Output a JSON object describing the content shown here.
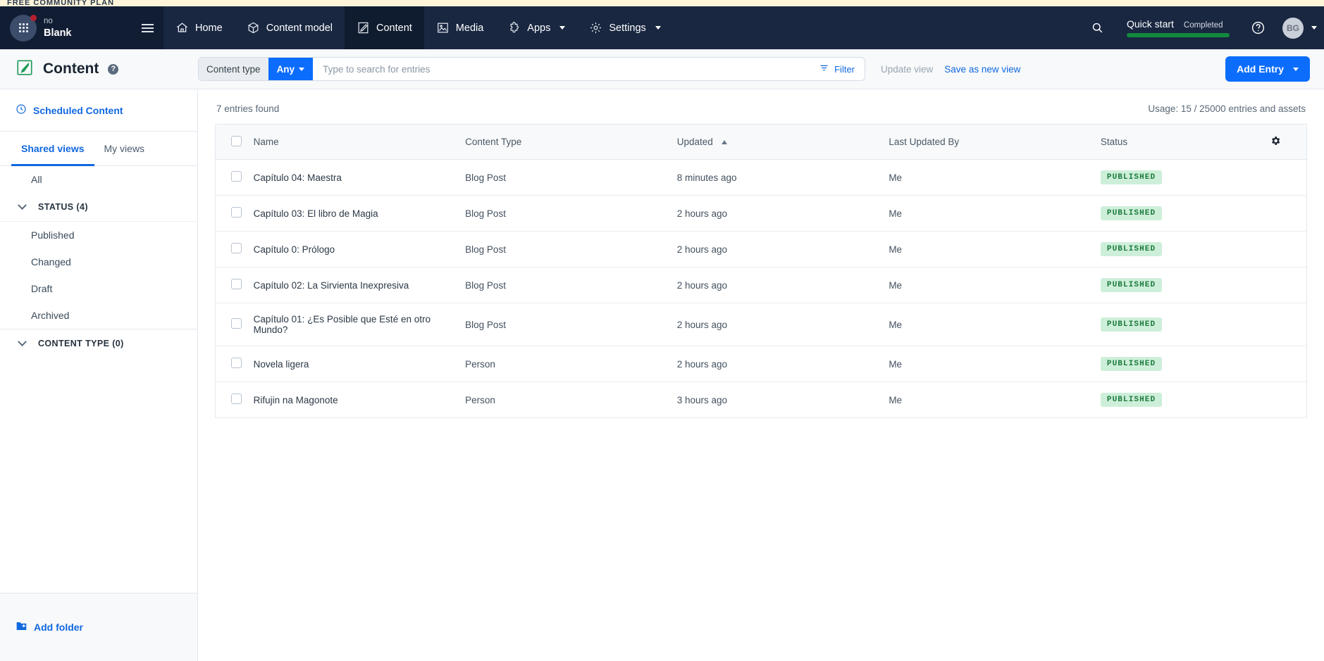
{
  "promo_banner": {
    "text": "FREE COMMUNITY PLAN"
  },
  "topnav": {
    "space": {
      "org_label": "no",
      "name": "Blank",
      "icon": "grid-apps-icon",
      "badge": "notification-dot"
    },
    "menu_icon": "hamburger-icon",
    "items": [
      {
        "label": "Home",
        "icon": "house-icon",
        "active": false,
        "has_caret": false
      },
      {
        "label": "Content model",
        "icon": "box-model-icon",
        "active": false,
        "has_caret": false
      },
      {
        "label": "Content",
        "icon": "pen-document-icon",
        "active": true,
        "has_caret": false
      },
      {
        "label": "Media",
        "icon": "image-frame-icon",
        "active": false,
        "has_caret": false
      },
      {
        "label": "Apps",
        "icon": "puzzle-piece-icon",
        "active": false,
        "has_caret": true
      },
      {
        "label": "Settings",
        "icon": "gear-icon",
        "active": false,
        "has_caret": true
      }
    ],
    "search_icon": "search-icon",
    "quick_start": {
      "title": "Quick start",
      "status": "Completed",
      "progress_percent": 100,
      "bar_color": "#128a3c"
    },
    "help_icon": "question-circle-icon",
    "avatar": {
      "initials": "BG"
    }
  },
  "page_header": {
    "icon": "content-pen-icon",
    "title": "Content",
    "help_icon": "question-circle-icon",
    "content_type_filter": {
      "label": "Content type",
      "value": "Any",
      "caret": "chevron-down-icon"
    },
    "search": {
      "placeholder": "Type to search for entries",
      "value": ""
    },
    "filter": {
      "label": "Filter",
      "icon": "filter-icon"
    },
    "update_view": "Update view",
    "save_as_new_view": "Save as new view",
    "add_entry": {
      "label": "Add Entry",
      "caret": "chevron-down-icon"
    }
  },
  "sidebar": {
    "scheduled_content": {
      "label": "Scheduled Content",
      "icon": "clock-icon"
    },
    "tabs": [
      {
        "label": "Shared views",
        "active": true
      },
      {
        "label": "My views",
        "active": false
      }
    ],
    "all_label": "All",
    "groups": [
      {
        "label": "STATUS (4)",
        "expanded": true,
        "items": [
          {
            "label": "Published"
          },
          {
            "label": "Changed"
          },
          {
            "label": "Draft"
          },
          {
            "label": "Archived"
          }
        ]
      },
      {
        "label": "CONTENT TYPE (0)",
        "expanded": true,
        "items": []
      }
    ],
    "add_folder": {
      "label": "Add folder",
      "icon": "folder-plus-icon"
    }
  },
  "main": {
    "entries_found": "7 entries found",
    "usage": "Usage: 15 / 25000 entries and assets",
    "columns": {
      "name": "Name",
      "content_type": "Content Type",
      "updated": "Updated",
      "updated_sort": "ascending",
      "last_updated_by": "Last Updated By",
      "status": "Status",
      "settings_icon": "gear-icon"
    },
    "rows": [
      {
        "name": "Capítulo 04: Maestra",
        "content_type": "Blog Post",
        "updated": "8 minutes ago",
        "last_updated_by": "Me",
        "status": "PUBLISHED"
      },
      {
        "name": "Capítulo 03: El libro de Magia",
        "content_type": "Blog Post",
        "updated": "2 hours ago",
        "last_updated_by": "Me",
        "status": "PUBLISHED"
      },
      {
        "name": "Capítulo 0: Prólogo",
        "content_type": "Blog Post",
        "updated": "2 hours ago",
        "last_updated_by": "Me",
        "status": "PUBLISHED"
      },
      {
        "name": "Capítulo 02: La Sirvienta Inexpresiva",
        "content_type": "Blog Post",
        "updated": "2 hours ago",
        "last_updated_by": "Me",
        "status": "PUBLISHED"
      },
      {
        "name": "Capítulo 01: ¿Es Posible que Esté en otro Mundo?",
        "content_type": "Blog Post",
        "updated": "2 hours ago",
        "last_updated_by": "Me",
        "status": "PUBLISHED"
      },
      {
        "name": "Novela ligera",
        "content_type": "Person",
        "updated": "2 hours ago",
        "last_updated_by": "Me",
        "status": "PUBLISHED"
      },
      {
        "name": "Rifujin na Magonote",
        "content_type": "Person",
        "updated": "3 hours ago",
        "last_updated_by": "Me",
        "status": "PUBLISHED"
      }
    ]
  },
  "colors": {
    "accent_blue": "#0c6dfd",
    "nav_dark": "#192741",
    "nav_dark_active": "#0f1b2e",
    "status_green_bg": "#cdefd9",
    "status_green_text": "#1b7a3d",
    "banner_yellow": "#fdf4d9"
  }
}
